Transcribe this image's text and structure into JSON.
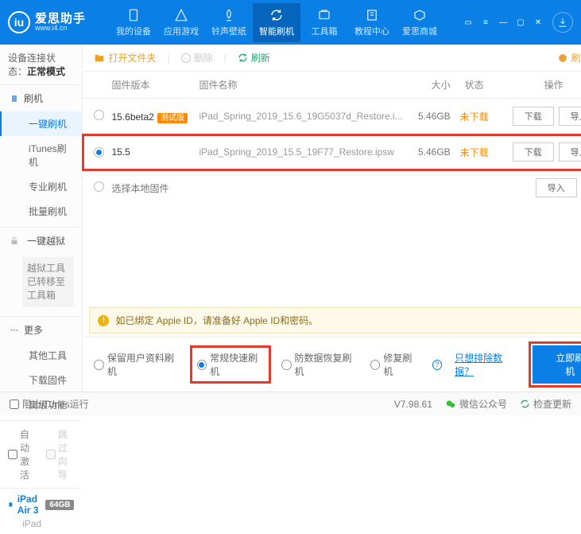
{
  "app": {
    "name": "爱思助手",
    "url": "www.i4.cn"
  },
  "nav": {
    "items": [
      "我的设备",
      "应用游戏",
      "铃声壁纸",
      "智能刷机",
      "工具箱",
      "教程中心",
      "爱思商城"
    ],
    "active": 3
  },
  "windowCtrl": [
    "▭",
    "≡",
    "—",
    "▢",
    "✕"
  ],
  "sidebar": {
    "statusLabel": "设备连接状态：",
    "statusValue": "正常模式",
    "groups": [
      {
        "head": "刷机",
        "icon": "flash",
        "items": [
          "一键刷机",
          "iTunes刷机",
          "专业刷机",
          "批量刷机"
        ],
        "active": 0
      },
      {
        "head": "一键越狱",
        "icon": "lock",
        "note": "越狱工具已转移至工具箱"
      },
      {
        "head": "更多",
        "items": [
          "其他工具",
          "下载固件",
          "高级功能"
        ]
      }
    ],
    "checks": {
      "auto": "自动激活",
      "skip": "跳过向导"
    },
    "device": {
      "name": "iPad Air 3",
      "storage": "64GB",
      "type": "iPad"
    }
  },
  "toolbar": {
    "open": "打开文件夹",
    "del": "删除",
    "refresh": "刷新",
    "settings": "刷机设置"
  },
  "table": {
    "head": {
      "ver": "固件版本",
      "name": "固件名称",
      "size": "大小",
      "status": "状态",
      "op": "操作"
    },
    "rows": [
      {
        "ver": "15.6beta2",
        "beta": "测试版",
        "name": "iPad_Spring_2019_15.6_19G5037d_Restore.i...",
        "size": "5.46GB",
        "status": "未下载",
        "sel": false
      },
      {
        "ver": "15.5",
        "name": "iPad_Spring_2019_15.5_19F77_Restore.ipsw",
        "size": "5.46GB",
        "status": "未下载",
        "sel": true
      }
    ],
    "local": "选择本地固件",
    "btn": {
      "dl": "下载",
      "imp": "导入"
    }
  },
  "warn": "如已绑定 Apple ID，请准备好 Apple ID和密码。",
  "options": {
    "opts": [
      "保留用户资料刷机",
      "常规快速刷机",
      "防数据恢复刷机",
      "修复刷机"
    ],
    "sel": 1,
    "link": "只想排除数据？",
    "action": "立即刷机"
  },
  "footer": {
    "itunes": "阻止iTunes运行",
    "ver": "V7.98.61",
    "wechat": "微信公众号",
    "update": "检查更新"
  }
}
